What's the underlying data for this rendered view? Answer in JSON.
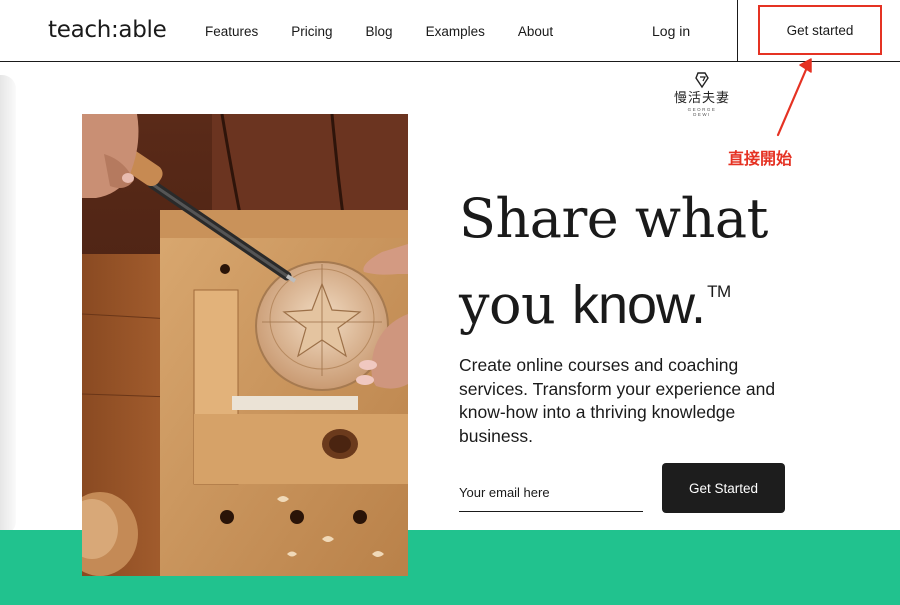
{
  "brand": {
    "logo": "teach:able"
  },
  "nav": {
    "items": [
      {
        "label": "Features"
      },
      {
        "label": "Pricing"
      },
      {
        "label": "Blog"
      },
      {
        "label": "Examples"
      },
      {
        "label": "About"
      }
    ],
    "login_label": "Log in",
    "get_started_label": "Get started"
  },
  "annotation": {
    "label": "直接開始",
    "color": "#e53223",
    "watermark": {
      "cn": "慢活夫妻",
      "en_top": "GEORGE",
      "en_bottom": "DEWI"
    }
  },
  "hero": {
    "title_line1": "Share what",
    "title_line2_a": "you ",
    "title_line2_b": "know.",
    "title_tm": "TM",
    "description": "Create online courses and coaching services. Transform your experience and know-how into a thriving knowledge business.",
    "email_placeholder": "Your email here",
    "cta_label": "Get Started",
    "photo_icon": "woodcarving-photo"
  },
  "colors": {
    "accent_green": "#21c28e",
    "cta_dark": "#1d1d1d",
    "annotation_red": "#e53223"
  }
}
